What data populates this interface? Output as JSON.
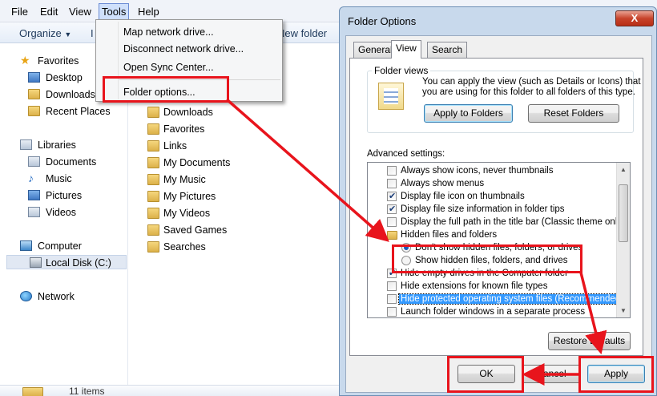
{
  "menubar": {
    "items": [
      "File",
      "Edit",
      "View",
      "Tools",
      "Help"
    ]
  },
  "toolbar": {
    "organize": "Organize",
    "new_folder_fragment": "New folder",
    "partial": "I"
  },
  "tools_menu": {
    "items": [
      "Map network drive...",
      "Disconnect network drive...",
      "Open Sync Center...",
      "Folder options..."
    ]
  },
  "nav": {
    "favorites": "Favorites",
    "desktop": "Desktop",
    "downloads": "Downloads",
    "recent": "Recent Places",
    "libraries": "Libraries",
    "documents": "Documents",
    "music": "Music",
    "pictures": "Pictures",
    "videos": "Videos",
    "computer": "Computer",
    "local_disk": "Local Disk (C:)",
    "network": "Network"
  },
  "files": [
    "Downloads",
    "Favorites",
    "Links",
    "My Documents",
    "My Music",
    "My Pictures",
    "My Videos",
    "Saved Games",
    "Searches"
  ],
  "status": {
    "count": "11 items"
  },
  "dialog": {
    "title": "Folder Options",
    "close": "X",
    "tabs": [
      "General",
      "View",
      "Search"
    ],
    "folder_views": {
      "legend": "Folder views",
      "desc_line1": "You can apply the view (such as Details or Icons) that",
      "desc_line2": "you are using for this folder to all folders of this type.",
      "apply_btn": "Apply to Folders",
      "reset_btn": "Reset Folders"
    },
    "advanced_label": "Advanced settings:",
    "advanced": [
      {
        "type": "checkbox",
        "checked": false,
        "label": "Always show icons, never thumbnails"
      },
      {
        "type": "checkbox",
        "checked": false,
        "label": "Always show menus"
      },
      {
        "type": "checkbox",
        "checked": true,
        "label": "Display file icon on thumbnails"
      },
      {
        "type": "checkbox",
        "checked": true,
        "label": "Display file size information in folder tips"
      },
      {
        "type": "checkbox",
        "checked": false,
        "label": "Display the full path in the title bar (Classic theme only)"
      },
      {
        "type": "folder",
        "label": "Hidden files and folders"
      },
      {
        "type": "radio",
        "checked": true,
        "label": "Don't show hidden files, folders, or drives"
      },
      {
        "type": "radio",
        "checked": false,
        "label": "Show hidden files, folders, and drives"
      },
      {
        "type": "checkbox",
        "checked": true,
        "label": "Hide empty drives in the Computer folder"
      },
      {
        "type": "checkbox",
        "checked": false,
        "label": "Hide extensions for known file types"
      },
      {
        "type": "checkbox",
        "checked": false,
        "label": "Hide protected operating system files (Recommended)"
      },
      {
        "type": "checkbox",
        "checked": false,
        "label": "Launch folder windows in a separate process"
      }
    ],
    "restore_btn": "Restore Defaults",
    "ok_btn": "OK",
    "cancel_btn": "Cancel",
    "apply_btn": "Apply"
  },
  "colors": {
    "annotation_red": "#e8141c",
    "selection_blue": "#3399ff"
  }
}
